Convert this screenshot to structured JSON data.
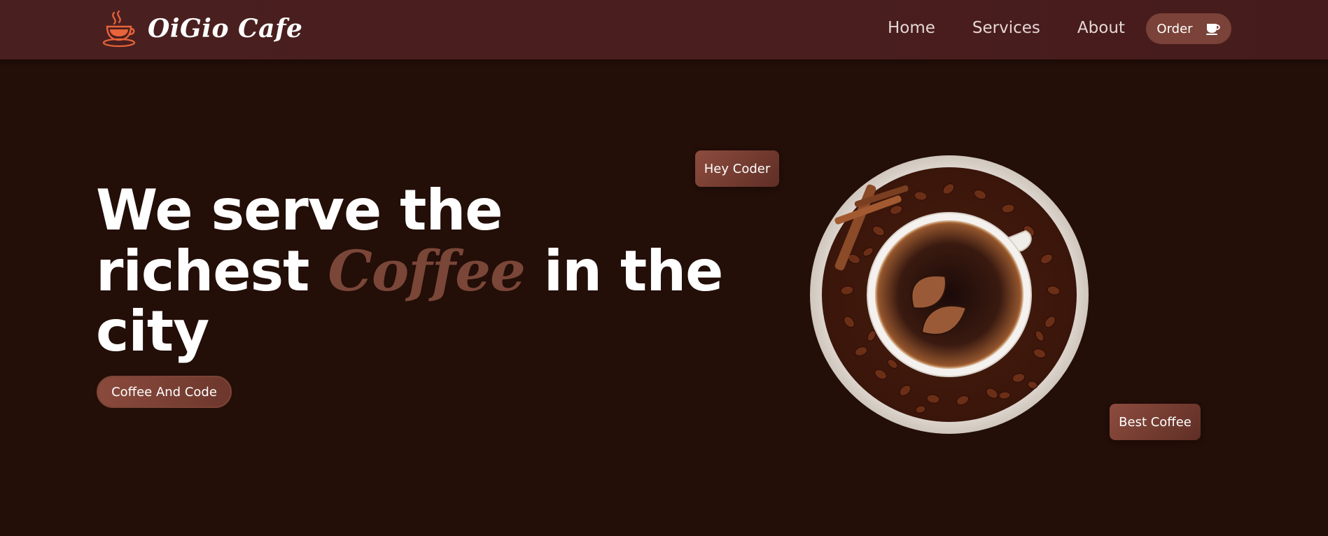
{
  "brand": {
    "name": "OiGio Cafe",
    "logo_icon": "coffee-cup-steam-icon"
  },
  "nav": {
    "items": [
      {
        "label": "Home"
      },
      {
        "label": "Services"
      },
      {
        "label": "About"
      }
    ],
    "order_button": {
      "label": "Order",
      "icon": "coffee-cup-icon"
    }
  },
  "hero": {
    "line1": "We serve the",
    "line2_pre": "richest ",
    "line2_accent": "Coffee",
    "line2_post": " in the",
    "line3": "city",
    "cta_label": "Coffee And Code"
  },
  "tags": {
    "top": "Hey Coder",
    "bottom": "Best Coffee"
  },
  "colors": {
    "background": "#230e08",
    "navbar": "#4a1f1f",
    "accent": "#7a4638",
    "logo_icon": "#e8643a"
  }
}
